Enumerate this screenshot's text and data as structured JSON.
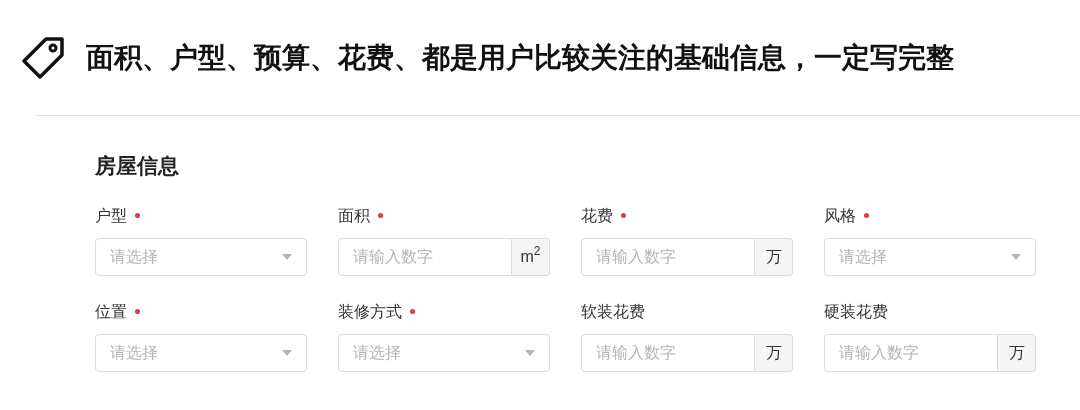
{
  "headline": "面积、户型、预算、花费、都是用户比较关注的基础信息，一定写完整",
  "section": {
    "title": "房屋信息",
    "fields": [
      {
        "label": "户型",
        "required": true,
        "kind": "select",
        "placeholder": "请选择"
      },
      {
        "label": "面积",
        "required": true,
        "kind": "unit",
        "placeholder": "请输入数字",
        "unit": "m$^{2}$"
      },
      {
        "label": "花费",
        "required": true,
        "kind": "unit",
        "placeholder": "请输入数字",
        "unit": "万"
      },
      {
        "label": "风格",
        "required": true,
        "kind": "select",
        "placeholder": "请选择"
      },
      {
        "label": "位置",
        "required": true,
        "kind": "select",
        "placeholder": "请选择"
      },
      {
        "label": "装修方式",
        "required": true,
        "kind": "select",
        "placeholder": "请选择"
      },
      {
        "label": "软装花费",
        "required": false,
        "kind": "unit",
        "placeholder": "请输入数字",
        "unit": "万"
      },
      {
        "label": "硬装花费",
        "required": false,
        "kind": "unit",
        "placeholder": "请输入数字",
        "unit": "万"
      }
    ]
  }
}
